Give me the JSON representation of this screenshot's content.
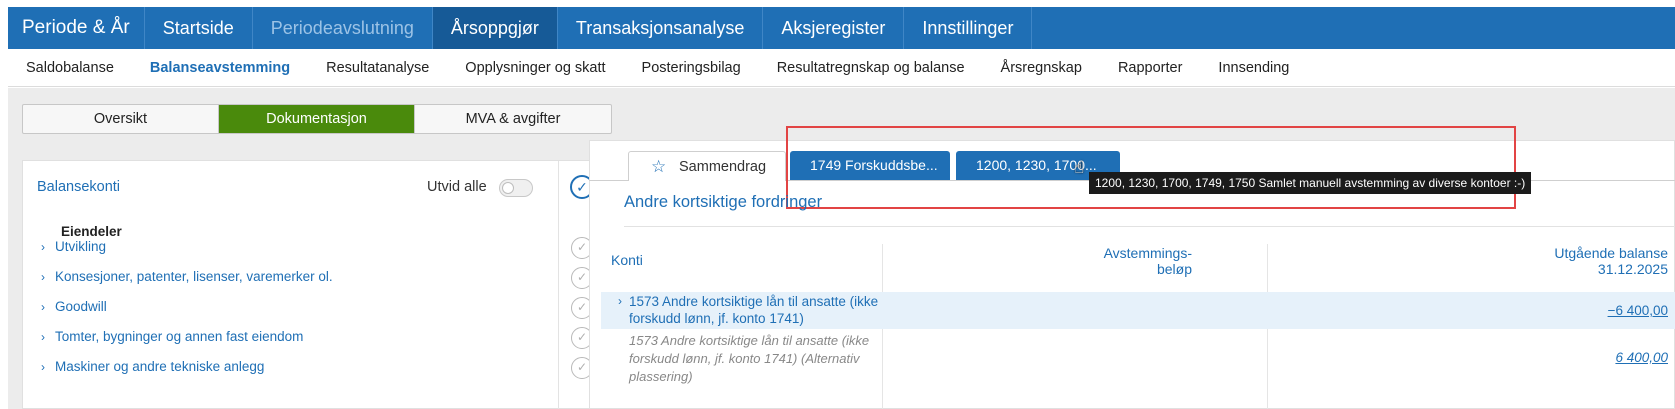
{
  "topnav": {
    "items": [
      {
        "label": "Periode & År"
      },
      {
        "label": "Startside"
      },
      {
        "label": "Periodeavslutning"
      },
      {
        "label": "Årsoppgjør"
      },
      {
        "label": "Transaksjonsanalyse"
      },
      {
        "label": "Aksjeregister"
      },
      {
        "label": "Innstillinger"
      }
    ]
  },
  "subnav": {
    "items": [
      {
        "label": "Saldobalanse"
      },
      {
        "label": "Balanseavstemming"
      },
      {
        "label": "Resultatanalyse"
      },
      {
        "label": "Opplysninger og skatt"
      },
      {
        "label": "Posteringsbilag"
      },
      {
        "label": "Resultatregnskap og balanse"
      },
      {
        "label": "Årsregnskap"
      },
      {
        "label": "Rapporter"
      },
      {
        "label": "Innsending"
      }
    ]
  },
  "segmented": {
    "items": [
      {
        "label": "Oversikt"
      },
      {
        "label": "Dokumentasjon"
      },
      {
        "label": "MVA & avgifter"
      }
    ]
  },
  "left": {
    "title": "Balansekonti",
    "expand_label": "Utvid alle",
    "section": "Eiendeler",
    "rows": [
      {
        "label": "Utvikling"
      },
      {
        "label": "Konsesjoner, patenter, lisenser, varemerker ol."
      },
      {
        "label": "Goodwill"
      },
      {
        "label": "Tomter, bygninger og annen fast eiendom"
      },
      {
        "label": "Maskiner og andre tekniske anlegg"
      }
    ]
  },
  "right": {
    "tabs": {
      "summary": "Sammendrag",
      "tab1": "1749 Forskuddsbe...",
      "tab2": "1200, 1230, 1700..."
    },
    "tooltip": "1200, 1230, 1700, 1749, 1750 Samlet manuell avstemming av diverse kontoer :-)",
    "group_title": "Andre kortsiktige fordringer",
    "table": {
      "headers": {
        "konti": "Konti",
        "avst_line1": "Avstemmings-",
        "avst_line2": "beløp",
        "utg_line1": "Utgående balanse",
        "utg_line2": "31.12.2025"
      },
      "rows": [
        {
          "text": "1573 Andre kortsiktige lån til ansatte (ikke forskudd lønn, jf. konto 1741)",
          "amount": "−6 400,00"
        },
        {
          "text": "1573 Andre kortsiktige lån til ansatte (ikke forskudd lønn, jf. konto 1741) (Alternativ plassering)",
          "amount": "6 400,00"
        }
      ]
    }
  },
  "colors": {
    "brand_blue": "#1f6fb5",
    "active_green": "#4a8a0c",
    "highlight_red": "#e24444"
  }
}
